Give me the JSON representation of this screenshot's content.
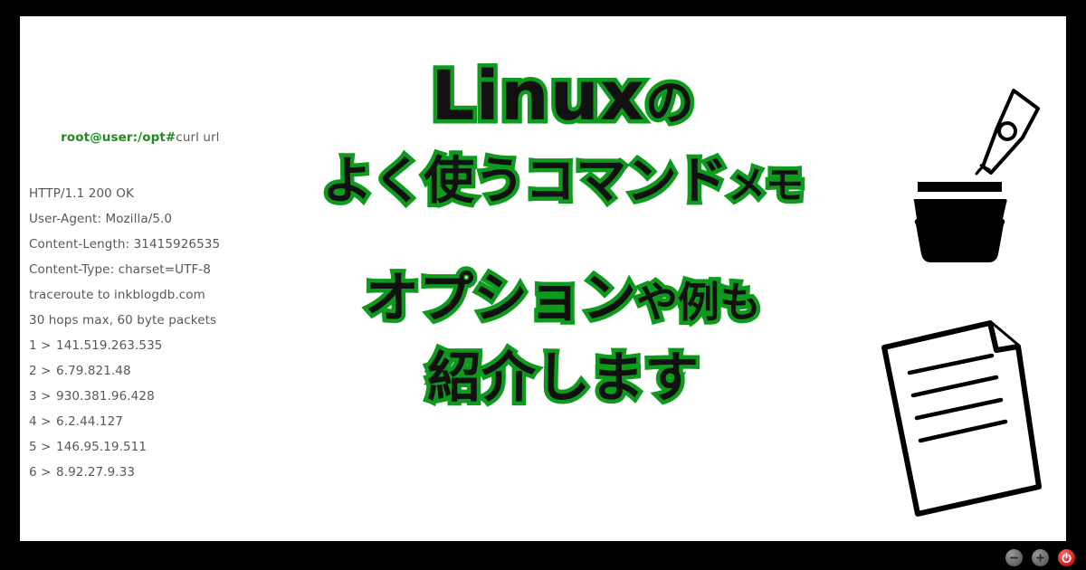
{
  "window": {
    "frame_color": "#000000",
    "canvas_color": "#ffffff"
  },
  "terminal": {
    "prompt_color": "#1f8b1f",
    "text_color": "#575757",
    "prompt": "root@user:/opt#",
    "command": "curl url",
    "lines": [
      "HTTP/1.1 200 OK",
      "User-Agent: Mozilla/5.0",
      "Content-Length: 31415926535",
      "Content-Type: charset=UTF-8",
      "traceroute to inkblogdb.com",
      "30 hops max, 60 byte packets"
    ],
    "hops": [
      {
        "index": "1 >",
        "address": "141.519.263.535"
      },
      {
        "index": "2 >",
        "address": "6.79.821.48"
      },
      {
        "index": "3 >",
        "address": "930.381.96.428"
      },
      {
        "index": "4 >",
        "address": "6.2.44.127"
      },
      {
        "index": "5 >",
        "address": "146.95.19.511"
      },
      {
        "index": "6 >",
        "address": "8.92.27.9.33"
      }
    ]
  },
  "headline": {
    "outline_color": "#0e9b1d",
    "fill_color": "#111111",
    "line1_main": "Linux",
    "line1_suffix": "の",
    "line2_a": "よく使う",
    "line2_b": "コマンド",
    "line2_c": "メモ",
    "line3_a": "オプション",
    "line3_b": "や例も",
    "line4": "紹介します"
  },
  "illustrations": {
    "pen_ink": "pen-nib-and-inkpot-icon",
    "document": "document-with-folded-corner-icon"
  },
  "bottom_bar": {
    "buttons": [
      {
        "name": "zoom-out-button",
        "glyph": "−",
        "color": "#6a6a6a"
      },
      {
        "name": "zoom-in-button",
        "glyph": "+",
        "color": "#6a6a6a"
      },
      {
        "name": "power-button",
        "glyph": "⏻",
        "color": "#d01515"
      }
    ]
  }
}
